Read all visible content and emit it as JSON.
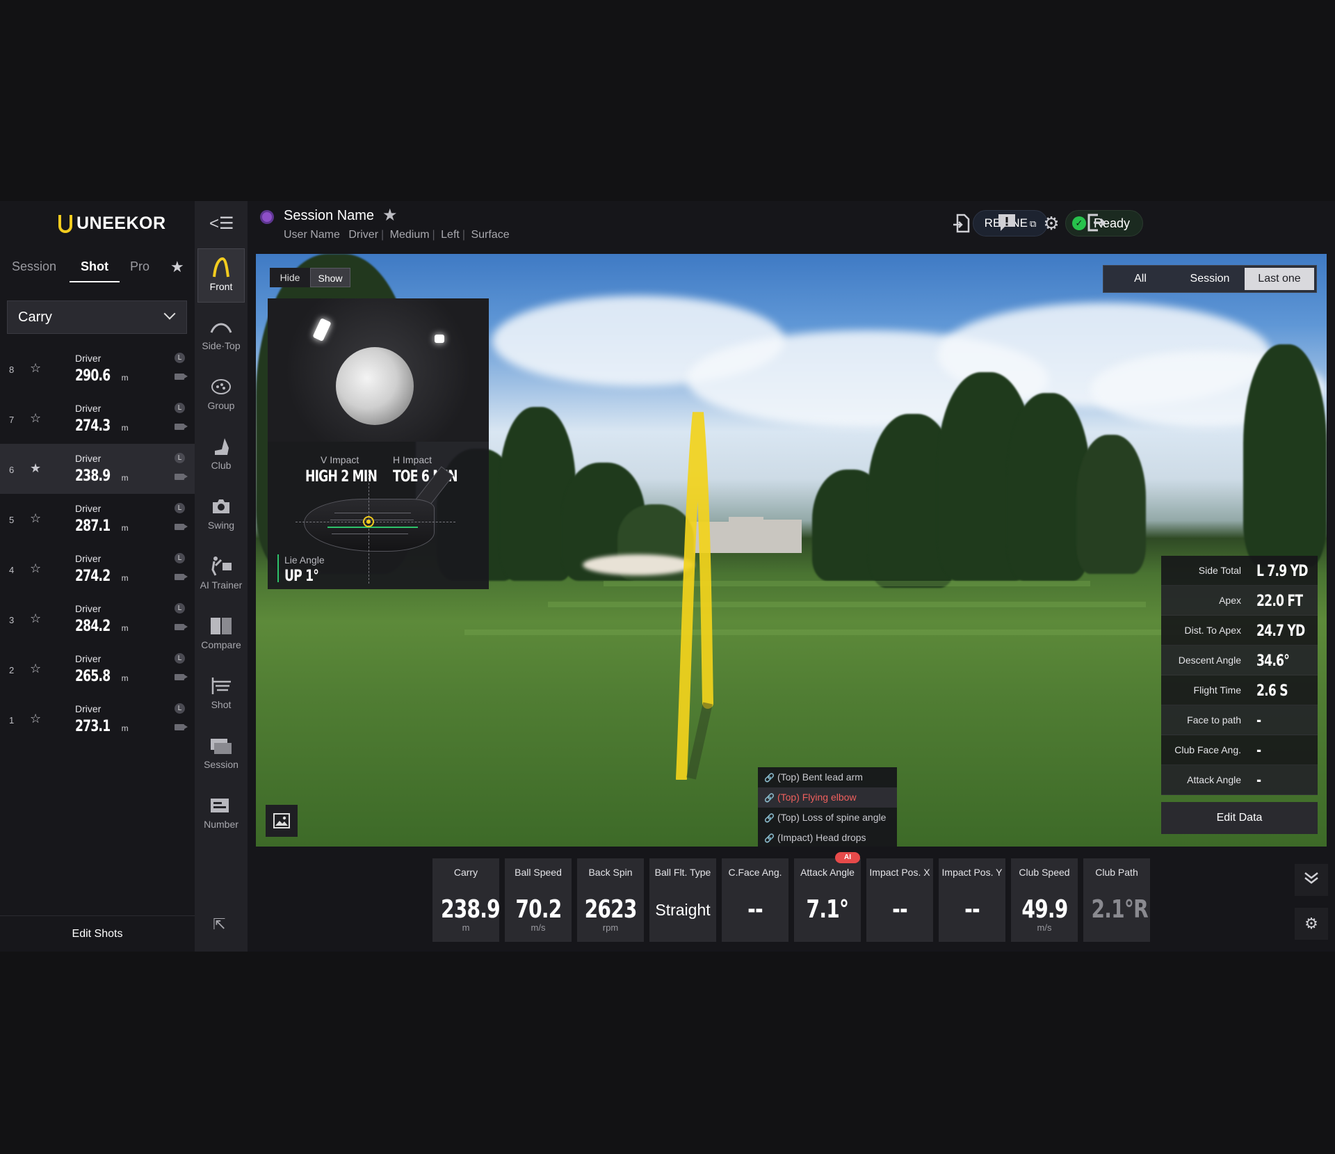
{
  "brand": {
    "logo_text": "UNEEKOR"
  },
  "left_panel": {
    "tabs": [
      "Session",
      "Shot",
      "Pro"
    ],
    "active_tab": "Shot",
    "dropdown_value": "Carry",
    "shots": [
      {
        "num": "8",
        "club": "Driver",
        "value": "290.6",
        "unit": "m",
        "badge": "L"
      },
      {
        "num": "7",
        "club": "Driver",
        "value": "274.3",
        "unit": "m",
        "badge": "L"
      },
      {
        "num": "6",
        "club": "Driver",
        "value": "238.9",
        "unit": "m",
        "badge": "L",
        "selected": true
      },
      {
        "num": "5",
        "club": "Driver",
        "value": "287.1",
        "unit": "m",
        "badge": "L"
      },
      {
        "num": "4",
        "club": "Driver",
        "value": "274.2",
        "unit": "m",
        "badge": "L"
      },
      {
        "num": "3",
        "club": "Driver",
        "value": "284.2",
        "unit": "m",
        "badge": "L"
      },
      {
        "num": "2",
        "club": "Driver",
        "value": "265.8",
        "unit": "m",
        "badge": "L"
      },
      {
        "num": "1",
        "club": "Driver",
        "value": "273.1",
        "unit": "m",
        "badge": "L"
      }
    ],
    "edit_shots_label": "Edit Shots"
  },
  "toolbar": {
    "tools": [
      {
        "label": "Front",
        "icon": "front-view-icon",
        "active": true
      },
      {
        "label": "Side·Top",
        "icon": "side-top-view-icon"
      },
      {
        "label": "Group",
        "icon": "group-icon"
      },
      {
        "label": "Club",
        "icon": "club-icon"
      },
      {
        "label": "Swing",
        "icon": "camera-icon"
      },
      {
        "label": "AI Trainer",
        "icon": "ai-trainer-icon"
      },
      {
        "label": "Compare",
        "icon": "compare-icon"
      },
      {
        "label": "Shot",
        "icon": "shot-icon"
      },
      {
        "label": "Session",
        "icon": "session-icon"
      },
      {
        "label": "Number",
        "icon": "number-icon"
      }
    ]
  },
  "header": {
    "session_name": "Session Name",
    "meta": [
      "User Name",
      "Driver",
      "Medium",
      "Left",
      "Surface"
    ],
    "refine_label": "REFINE",
    "status_label": "Ready",
    "colors": {
      "status": "#27c24c",
      "session_dot": "#8d4fc8"
    }
  },
  "scene": {
    "hide_label": "Hide",
    "show_label": "Show",
    "filters": [
      "All",
      "Session",
      "Last one"
    ],
    "active_filter": "Last one",
    "impact": {
      "v_label": "V Impact",
      "v_value": "HIGH 2 MIN",
      "h_label": "H Impact",
      "h_value": "TOE 6 MIN",
      "lie_label": "Lie Angle",
      "lie_value": "UP 1°"
    },
    "ai_faults": [
      {
        "label": "(Top) Bent lead arm"
      },
      {
        "label": "(Top) Flying elbow",
        "alert": true
      },
      {
        "label": "(Top) Loss of spine angle"
      },
      {
        "label": "(Impact) Head drops"
      }
    ],
    "stats": [
      {
        "label": "Side Total",
        "value": "L 7.9 YD"
      },
      {
        "label": "Apex",
        "value": "22.0 FT"
      },
      {
        "label": "Dist. To Apex",
        "value": "24.7 YD"
      },
      {
        "label": "Descent Angle",
        "value": "34.6°"
      },
      {
        "label": "Flight Time",
        "value": "2.6 S"
      },
      {
        "label": "Face to path",
        "value": "-"
      },
      {
        "label": "Club Face Ang.",
        "value": "-"
      },
      {
        "label": "Attack Angle",
        "value": "-"
      }
    ],
    "edit_data_label": "Edit Data",
    "trajectory_color": "#f2d21c"
  },
  "cards": [
    {
      "label": "Carry",
      "value": "238.9",
      "unit": "m"
    },
    {
      "label": "Ball Speed",
      "value": "70.2",
      "unit": "m/s"
    },
    {
      "label": "Back Spin",
      "value": "2623",
      "unit": "rpm"
    },
    {
      "label": "Ball Flt. Type",
      "value": "Straight",
      "unit": "",
      "text": true
    },
    {
      "label": "C.Face Ang.",
      "value": "--",
      "unit": ""
    },
    {
      "label": "Attack Angle",
      "value": "7.1°",
      "unit": "",
      "ai": true
    },
    {
      "label": "Impact Pos. X",
      "value": "--",
      "unit": ""
    },
    {
      "label": "Impact Pos. Y",
      "value": "--",
      "unit": ""
    },
    {
      "label": "Club Speed",
      "value": "49.9",
      "unit": "m/s"
    },
    {
      "label": "Club Path",
      "value": "2.1°R",
      "unit": "",
      "dim": true
    }
  ],
  "ai_badge": "AI"
}
